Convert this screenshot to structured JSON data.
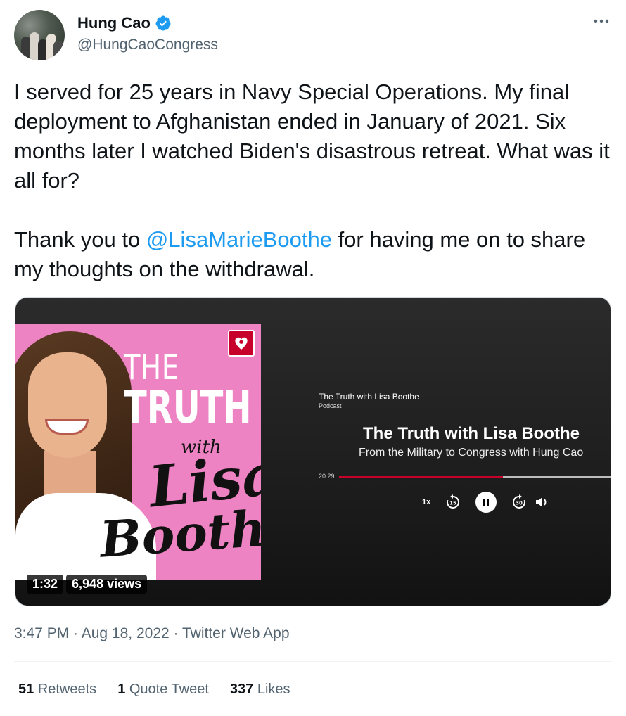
{
  "author": {
    "name": "Hung Cao",
    "handle": "@HungCaoCongress",
    "verified": true
  },
  "tweet": {
    "paragraph1": "I served for 25 years in Navy Special Operations. My final deployment to Afghanistan ended in January of 2021. Six months later I watched Biden's disastrous retreat. What was it all for?",
    "paragraph2_before": "Thank you to ",
    "mention": "@LisaMarieBoothe",
    "paragraph2_after": " for having me on to share my thoughts on the withdrawal."
  },
  "media": {
    "cover": {
      "the": "THE",
      "truth": "TRUTH",
      "with": "with",
      "lisa": "Lisa",
      "boothe": "Boothe"
    },
    "podcast_label": "The Truth with Lisa Boothe",
    "podcast_type": "Podcast",
    "episode_title": "The Truth with Lisa Boothe",
    "episode_subtitle": "From the Military to Congress with Hung Cao",
    "elapsed": "20:29",
    "progress": 0.6,
    "speed": "1x",
    "duration": "1:32",
    "views": "6,948 views"
  },
  "meta": {
    "time": "3:47 PM",
    "date": "Aug 18, 2022",
    "source": "Twitter Web App",
    "separator": " · "
  },
  "stats": {
    "retweets_count": "51",
    "retweets_label": "Retweets",
    "quotes_count": "1",
    "quotes_label": "Quote Tweet",
    "likes_count": "337",
    "likes_label": "Likes"
  },
  "colors": {
    "link": "#1d9bf0",
    "accent_red": "#c6002b",
    "cover_pink": "#ee83c4"
  }
}
